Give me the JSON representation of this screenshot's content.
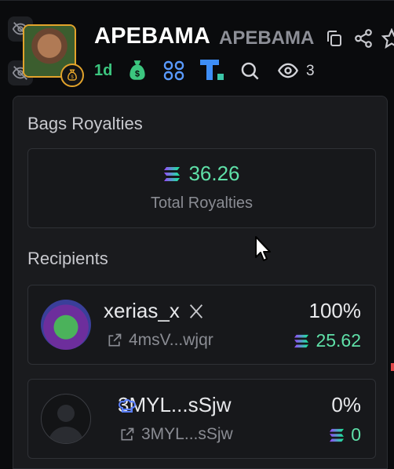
{
  "header": {
    "title": "APEBAMA",
    "ticker": "APEBAMA",
    "age": "1d",
    "views_count": "3"
  },
  "panel": {
    "title": "Bags Royalties",
    "total": {
      "value": "36.26",
      "label": "Total Royalties"
    },
    "recipients_title": "Recipients",
    "recipients": [
      {
        "name": "xerias_x",
        "address": "4msV...wjqr",
        "percent": "100%",
        "amount": "25.62",
        "platform_icon": "x-logo-icon"
      },
      {
        "name": "3MYL...sSjw",
        "address": "3MYL...sSjw",
        "percent": "0%",
        "amount": "0",
        "platform_icon": "chef-hat-icon"
      }
    ]
  },
  "colors": {
    "accent_green": "#5fe0a8",
    "badge_gold": "#e2a32b",
    "panel_bg": "#1a1b1e"
  }
}
